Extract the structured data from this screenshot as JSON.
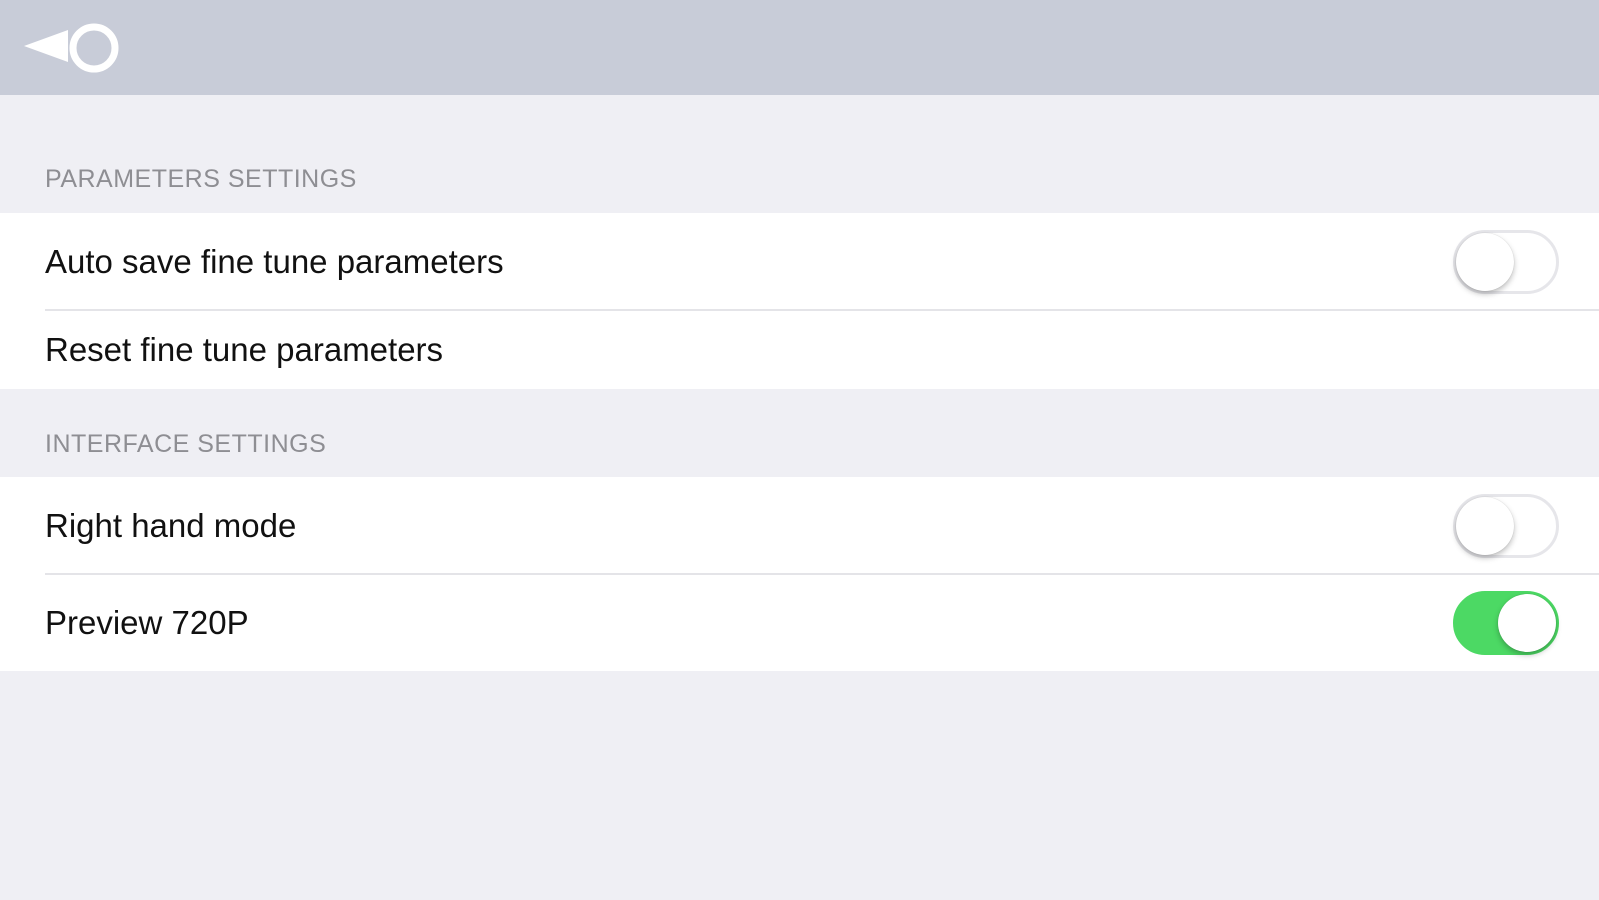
{
  "navbar": {
    "back_icon": "back-target-icon"
  },
  "sections": [
    {
      "header": "PARAMETERS SETTINGS",
      "rows": [
        {
          "label": "Auto save fine tune parameters",
          "toggle": false
        },
        {
          "label": "Reset fine tune parameters"
        }
      ]
    },
    {
      "header": "INTERFACE SETTINGS",
      "rows": [
        {
          "label": "Right hand mode",
          "toggle": false
        },
        {
          "label": "Preview 720P",
          "toggle": true
        }
      ]
    }
  ],
  "colors": {
    "navbar": "#c8ccd8",
    "background": "#efeff4",
    "toggle_on": "#4cd964"
  }
}
